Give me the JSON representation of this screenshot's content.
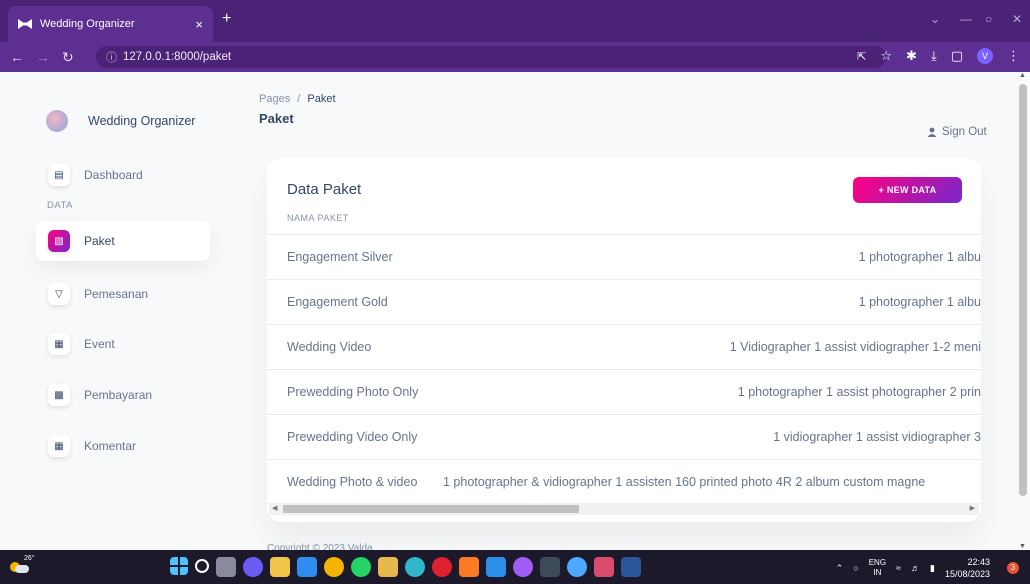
{
  "browser": {
    "tab_title": "Wedding Organizer",
    "tab_close": "×",
    "new_tab": "+",
    "url": "127.0.0.1:8000/paket",
    "profile_initial": "V"
  },
  "sidebar": {
    "brand": "Wedding Organizer",
    "section_label": "DATA",
    "items": [
      {
        "label": "Dashboard",
        "icon": "store-icon"
      },
      {
        "label": "Paket",
        "icon": "chart-icon"
      },
      {
        "label": "Pemesanan",
        "icon": "cart-icon"
      },
      {
        "label": "Event",
        "icon": "calendar-icon"
      },
      {
        "label": "Pembayaran",
        "icon": "money-icon"
      },
      {
        "label": "Komentar",
        "icon": "calendar-icon"
      }
    ]
  },
  "header": {
    "breadcrumb_root": "Pages",
    "breadcrumb_sep": "/",
    "breadcrumb_current": "Paket",
    "title": "Paket",
    "signout": "Sign Out"
  },
  "card": {
    "title": "Data Paket",
    "new_button": "+ NEW DATA",
    "column_header": "NAMA PAKET",
    "rows": [
      {
        "name": "Engagement Silver",
        "desc": "1 photographer 1 albu"
      },
      {
        "name": "Engagement Gold",
        "desc": "1 photographer 1 albu"
      },
      {
        "name": "Wedding Video",
        "desc": "1 Vidiographer 1 assist vidiographer 1-2 meni"
      },
      {
        "name": "Prewedding Photo Only",
        "desc": "1 photographer 1 assist photographer 2 prin"
      },
      {
        "name": "Prewedding Video Only",
        "desc": "1 vidiographer 1 assist vidiographer 3"
      },
      {
        "name": "Wedding Photo & video",
        "desc": "1 photographer & vidiographer 1 assisten 160 printed photo 4R 2 album custom magne"
      }
    ]
  },
  "footer": "Copyright © 2023 Valda",
  "taskbar": {
    "temperature": "26°",
    "lang_line1": "ENG",
    "lang_line2": "IN",
    "time": "22:43",
    "date": "15/08/2023",
    "notification_count": "3"
  },
  "colors": {
    "browser_frame": "#4a2377",
    "accent_gradient_start": "#7928ca",
    "accent_gradient_end": "#ff0080",
    "text_dark": "#344767",
    "text_muted": "#67748e"
  }
}
